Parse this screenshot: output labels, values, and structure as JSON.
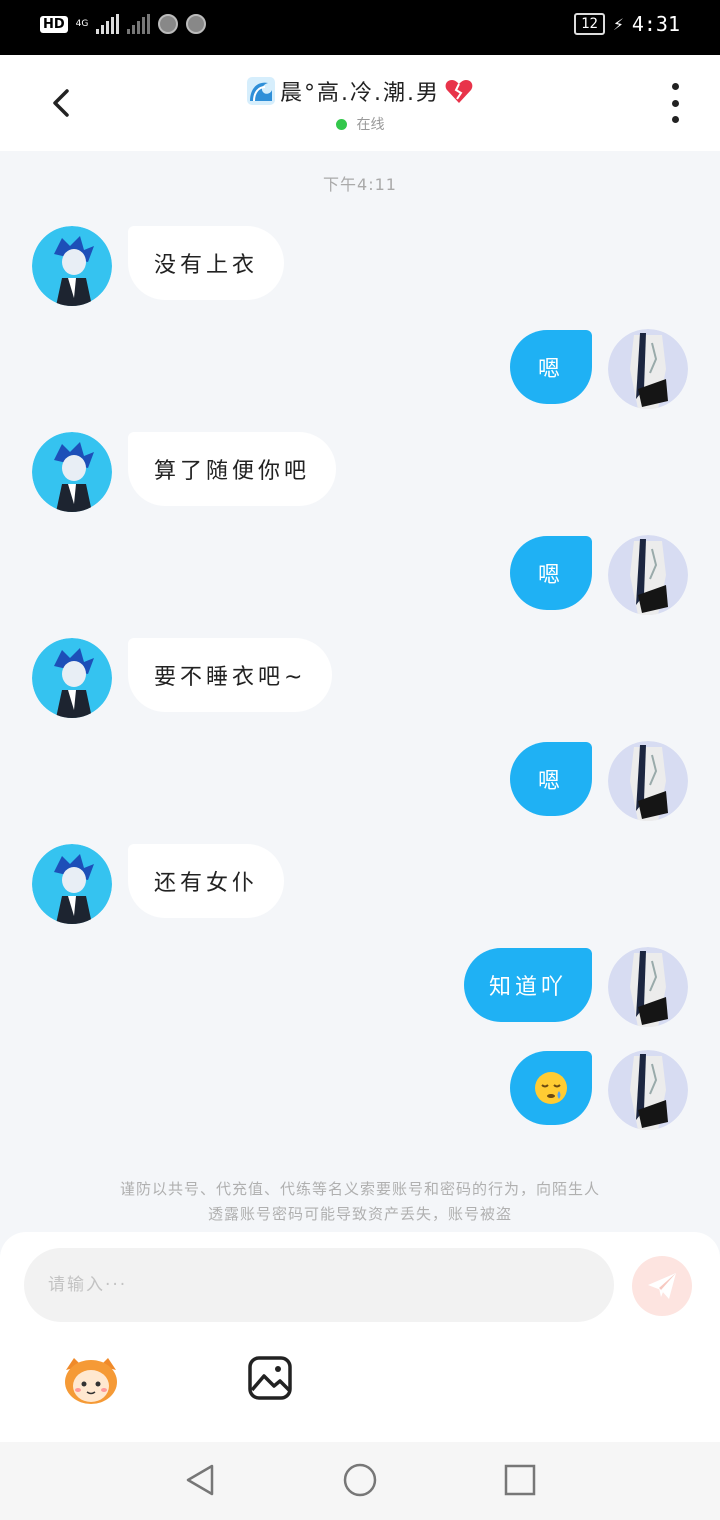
{
  "status_bar": {
    "hd": "HD",
    "network": "4G",
    "battery": "12",
    "time": "4:31"
  },
  "header": {
    "title": "晨°高.冷.潮.男",
    "status": "在线"
  },
  "chat": {
    "time_label": "下午4:11",
    "messages": [
      {
        "from": "them",
        "text": "没有上衣"
      },
      {
        "from": "me",
        "text": "嗯"
      },
      {
        "from": "them",
        "text": "算了随便你吧"
      },
      {
        "from": "me",
        "text": "嗯"
      },
      {
        "from": "them",
        "text": "要不睡衣吧~"
      },
      {
        "from": "me",
        "text": "嗯"
      },
      {
        "from": "them",
        "text": "还有女仆"
      },
      {
        "from": "me",
        "text": "知道吖"
      },
      {
        "from": "me",
        "emoji": "sleepy-face"
      }
    ]
  },
  "notice": {
    "line1": "谨防以共号、代充值、代练等名义索要账号和密码的行为，向陌生人",
    "line2": "透露账号密码可能导致资产丢失，账号被盗"
  },
  "composer": {
    "placeholder": "请输入···"
  },
  "icons": {
    "back": "chevron-left-icon",
    "more": "more-vertical-icon",
    "send": "paper-plane-icon",
    "emoji": "mascot-emoji-icon",
    "image": "image-icon"
  },
  "colors": {
    "accent": "#1fb1f4",
    "online": "#33c74b",
    "send_button": "#fde4e0",
    "background": "#f4f6f9"
  }
}
